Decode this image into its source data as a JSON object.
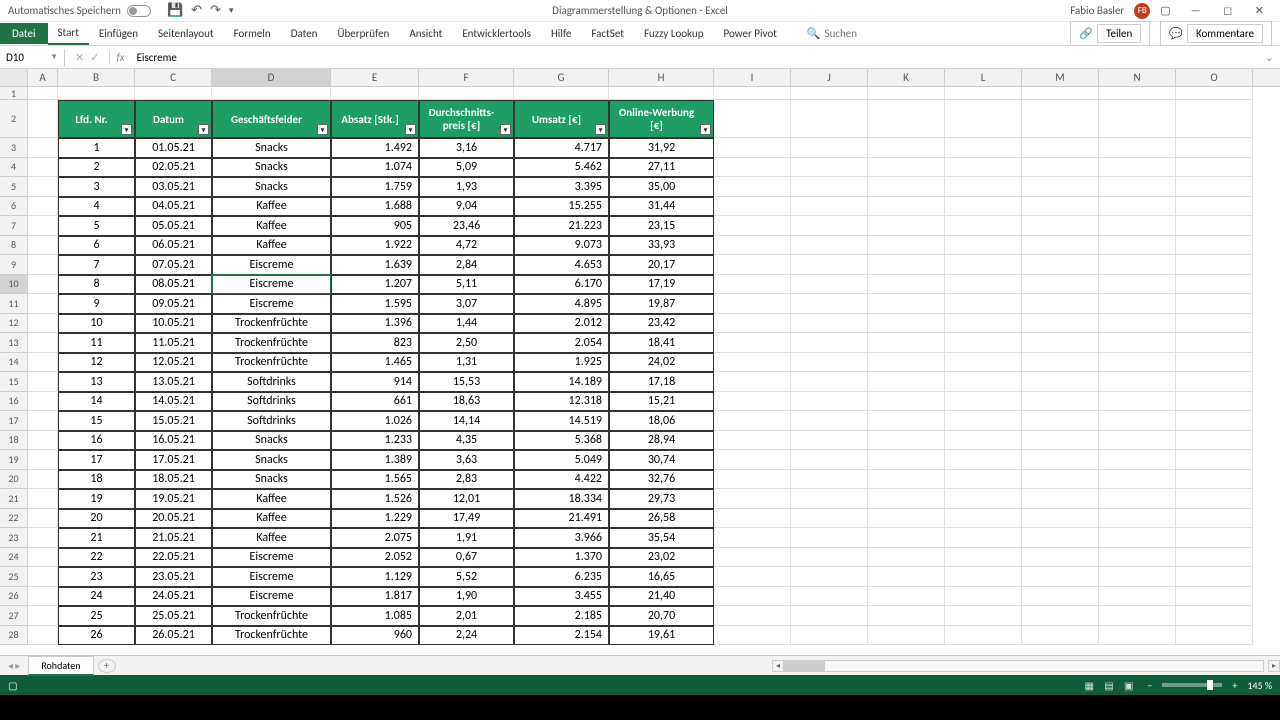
{
  "titlebar": {
    "autosave": "Automatisches Speichern",
    "doc_title": "Diagrammerstellung & Optionen  -  Excel",
    "user_name": "Fabio Basler",
    "user_initials": "FB"
  },
  "ribbon": {
    "file": "Datei",
    "tabs": [
      "Start",
      "Einfügen",
      "Seitenlayout",
      "Formeln",
      "Daten",
      "Überprüfen",
      "Ansicht",
      "Entwicklertools",
      "Hilfe",
      "FactSet",
      "Fuzzy Lookup",
      "Power Pivot"
    ],
    "search": "Suchen",
    "share": "Teilen",
    "comments": "Kommentare"
  },
  "namebox": "D10",
  "formula": "Eiscreme",
  "columns": [
    "A",
    "B",
    "C",
    "D",
    "E",
    "F",
    "G",
    "H",
    "I",
    "J",
    "K",
    "L",
    "M",
    "N",
    "O"
  ],
  "headers": [
    "Lfd. Nr.",
    "Datum",
    "Geschäftsfelder",
    "Absatz  [Stk.]",
    "Durchschnitts-preis [€]",
    "Umsatz [€]",
    "Online-Werbung [€]"
  ],
  "rows": [
    {
      "n": "1",
      "d": "01.05.21",
      "g": "Snacks",
      "a": "1.492",
      "p": "3,16",
      "u": "4.717",
      "o": "31,92"
    },
    {
      "n": "2",
      "d": "02.05.21",
      "g": "Snacks",
      "a": "1.074",
      "p": "5,09",
      "u": "5.462",
      "o": "27,11"
    },
    {
      "n": "3",
      "d": "03.05.21",
      "g": "Snacks",
      "a": "1.759",
      "p": "1,93",
      "u": "3.395",
      "o": "35,00"
    },
    {
      "n": "4",
      "d": "04.05.21",
      "g": "Kaffee",
      "a": "1.688",
      "p": "9,04",
      "u": "15.255",
      "o": "31,44"
    },
    {
      "n": "5",
      "d": "05.05.21",
      "g": "Kaffee",
      "a": "905",
      "p": "23,46",
      "u": "21.223",
      "o": "23,15"
    },
    {
      "n": "6",
      "d": "06.05.21",
      "g": "Kaffee",
      "a": "1.922",
      "p": "4,72",
      "u": "9.073",
      "o": "33,93"
    },
    {
      "n": "7",
      "d": "07.05.21",
      "g": "Eiscreme",
      "a": "1.639",
      "p": "2,84",
      "u": "4.653",
      "o": "20,17"
    },
    {
      "n": "8",
      "d": "08.05.21",
      "g": "Eiscreme",
      "a": "1.207",
      "p": "5,11",
      "u": "6.170",
      "o": "17,19"
    },
    {
      "n": "9",
      "d": "09.05.21",
      "g": "Eiscreme",
      "a": "1.595",
      "p": "3,07",
      "u": "4.895",
      "o": "19,87"
    },
    {
      "n": "10",
      "d": "10.05.21",
      "g": "Trockenfrüchte",
      "a": "1.396",
      "p": "1,44",
      "u": "2.012",
      "o": "23,42"
    },
    {
      "n": "11",
      "d": "11.05.21",
      "g": "Trockenfrüchte",
      "a": "823",
      "p": "2,50",
      "u": "2.054",
      "o": "18,41"
    },
    {
      "n": "12",
      "d": "12.05.21",
      "g": "Trockenfrüchte",
      "a": "1.465",
      "p": "1,31",
      "u": "1.925",
      "o": "24,02"
    },
    {
      "n": "13",
      "d": "13.05.21",
      "g": "Softdrinks",
      "a": "914",
      "p": "15,53",
      "u": "14.189",
      "o": "17,18"
    },
    {
      "n": "14",
      "d": "14.05.21",
      "g": "Softdrinks",
      "a": "661",
      "p": "18,63",
      "u": "12.318",
      "o": "15,21"
    },
    {
      "n": "15",
      "d": "15.05.21",
      "g": "Softdrinks",
      "a": "1.026",
      "p": "14,14",
      "u": "14.519",
      "o": "18,06"
    },
    {
      "n": "16",
      "d": "16.05.21",
      "g": "Snacks",
      "a": "1.233",
      "p": "4,35",
      "u": "5.368",
      "o": "28,94"
    },
    {
      "n": "17",
      "d": "17.05.21",
      "g": "Snacks",
      "a": "1.389",
      "p": "3,63",
      "u": "5.049",
      "o": "30,74"
    },
    {
      "n": "18",
      "d": "18.05.21",
      "g": "Snacks",
      "a": "1.565",
      "p": "2,83",
      "u": "4.422",
      "o": "32,76"
    },
    {
      "n": "19",
      "d": "19.05.21",
      "g": "Kaffee",
      "a": "1.526",
      "p": "12,01",
      "u": "18.334",
      "o": "29,73"
    },
    {
      "n": "20",
      "d": "20.05.21",
      "g": "Kaffee",
      "a": "1.229",
      "p": "17,49",
      "u": "21.491",
      "o": "26,58"
    },
    {
      "n": "21",
      "d": "21.05.21",
      "g": "Kaffee",
      "a": "2.075",
      "p": "1,91",
      "u": "3.966",
      "o": "35,54"
    },
    {
      "n": "22",
      "d": "22.05.21",
      "g": "Eiscreme",
      "a": "2.052",
      "p": "0,67",
      "u": "1.370",
      "o": "23,02"
    },
    {
      "n": "23",
      "d": "23.05.21",
      "g": "Eiscreme",
      "a": "1.129",
      "p": "5,52",
      "u": "6.235",
      "o": "16,65"
    },
    {
      "n": "24",
      "d": "24.05.21",
      "g": "Eiscreme",
      "a": "1.817",
      "p": "1,90",
      "u": "3.455",
      "o": "21,40"
    },
    {
      "n": "25",
      "d": "25.05.21",
      "g": "Trockenfrüchte",
      "a": "1.085",
      "p": "2,01",
      "u": "2.185",
      "o": "20,70"
    },
    {
      "n": "26",
      "d": "26.05.21",
      "g": "Trockenfrüchte",
      "a": "960",
      "p": "2,24",
      "u": "2.154",
      "o": "19,61"
    }
  ],
  "sheet": "Rohdaten",
  "zoom": "145 %"
}
